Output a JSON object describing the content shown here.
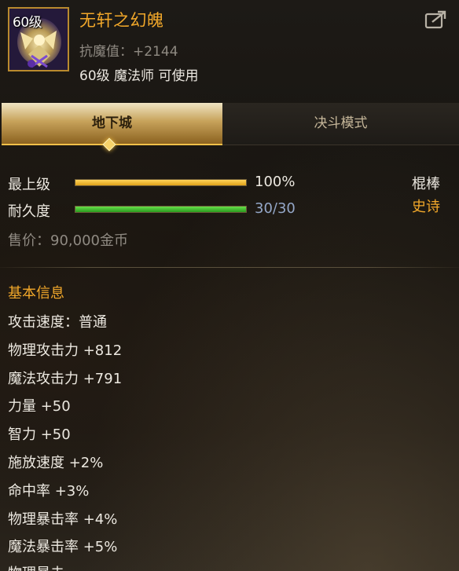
{
  "item": {
    "level_badge": "60级",
    "name": "无轩之幻魄",
    "anti_magic": "抗魔值：+2144",
    "class_requirement": "60级 魔法师 可使用",
    "icon": "mage-staff-item-icon"
  },
  "header": {
    "share_icon": "share-export-icon"
  },
  "tabs": [
    {
      "label": "地下城",
      "active": true
    },
    {
      "label": "决斗模式",
      "active": false
    }
  ],
  "stats": {
    "grade": {
      "label": "最上级",
      "value": "100%",
      "fill": 1.0
    },
    "durability": {
      "label": "耐久度",
      "value": "30/30",
      "fill": 1.0
    },
    "weapon_type": "棍棒",
    "rarity": "史诗",
    "sell_price": "售价：90,000金币"
  },
  "basic_info": {
    "title": "基本信息",
    "lines": [
      "攻击速度：普通",
      "物理攻击力 +812",
      "魔法攻击力 +791",
      "力量 +50",
      "智力 +50",
      "施放速度 +2%",
      "命中率 +3%",
      "物理暴击率 +4%",
      "魔法暴击率 +5%"
    ],
    "cut_off_line": "物理暴击"
  },
  "colors": {
    "item_name": "#f2a82a",
    "rarity": "#f2a82a",
    "section_title": "#f2a82a",
    "grade_bar": "#f0b62a",
    "durability_bar": "#3fc42c",
    "durability_value": "#94a7c8",
    "muted_text": "#8f8a82"
  }
}
